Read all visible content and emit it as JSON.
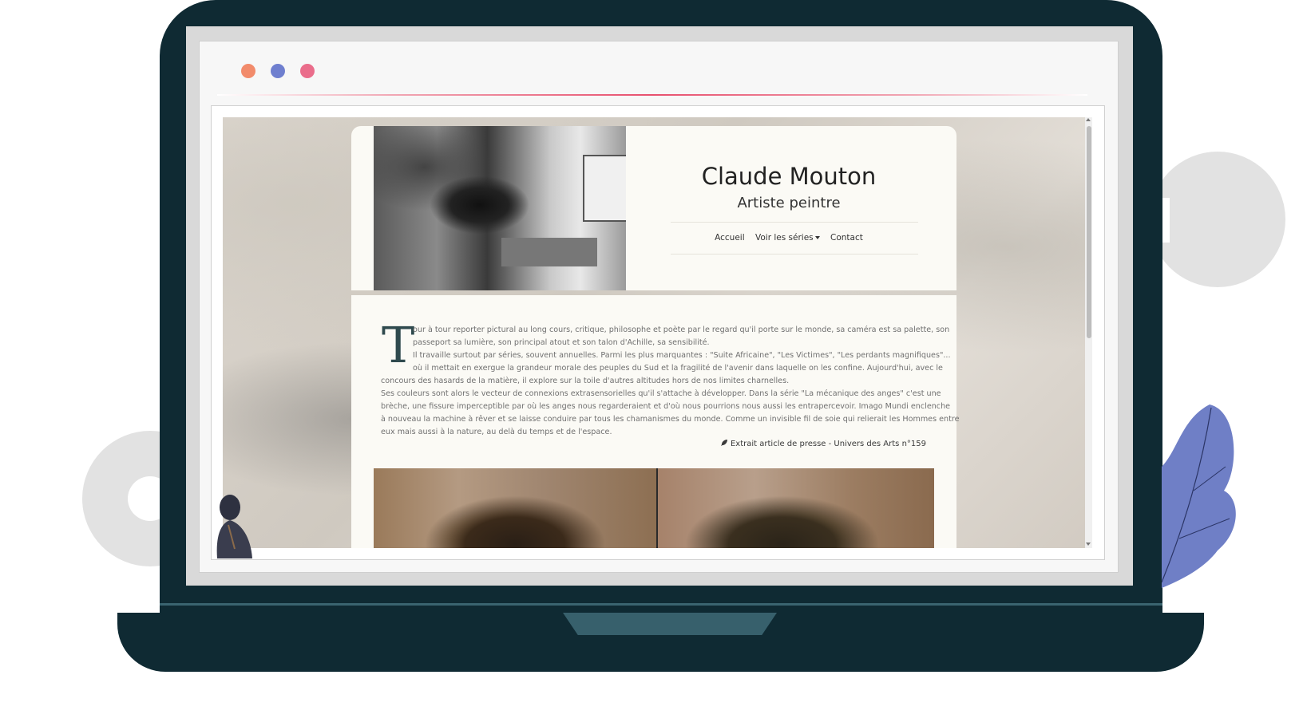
{
  "browser": {
    "window_dots": [
      {
        "color": "#f28b6b"
      },
      {
        "color": "#6f7fcf"
      },
      {
        "color": "#ea6d8b"
      }
    ]
  },
  "site": {
    "artist_name": "Claude Mouton",
    "artist_subtitle": "Artiste peintre",
    "nav": {
      "home": "Accueil",
      "series": "Voir les séries",
      "contact": "Contact"
    },
    "intro": {
      "dropcap": "T",
      "lines": [
        "our à tour reporter pictural au long cours, critique, philosophe et poète par le regard qu'il porte sur le monde, sa caméra est sa palette, son",
        "passeport sa lumière, son principal atout et son talon d'Achille, sa sensibilité.",
        "Il travaille surtout par séries, souvent annuelles. Parmi les plus marquantes : \"Suite Africaine\", \"Les Victimes\", \"Les perdants magnifiques\"...",
        "où il mettait en exergue la grandeur morale des peuples du Sud et la fragilité de l'avenir dans laquelle on les confine. Aujourd'hui, avec le",
        "concours des hasards de la matière, il explore sur la toile d'autres altitudes hors de nos limites charnelles.",
        "Ses couleurs sont alors le vecteur de connexions extrasensorielles qu'il s'attache à développer. Dans la série \"La mécanique des anges\" c'est une",
        "brèche, une fissure imperceptible par où les anges nous regarderaient et d'où nous pourrions nous aussi les entrapercevoir. Imago Mundi enclenche",
        "à nouveau la machine à rêver et se laisse conduire par tous les chamanismes du monde. Comme un invisible fil de soie qui relierait les Hommes entre",
        "eux mais aussi à la nature, au delà du temps et de l'espace."
      ],
      "source": "Extrait article de presse - Univers des Arts n°159"
    }
  },
  "colors": {
    "laptop": "#0f2a33",
    "accent_line": "#e8506e",
    "leaf": "#6f7fc6"
  }
}
